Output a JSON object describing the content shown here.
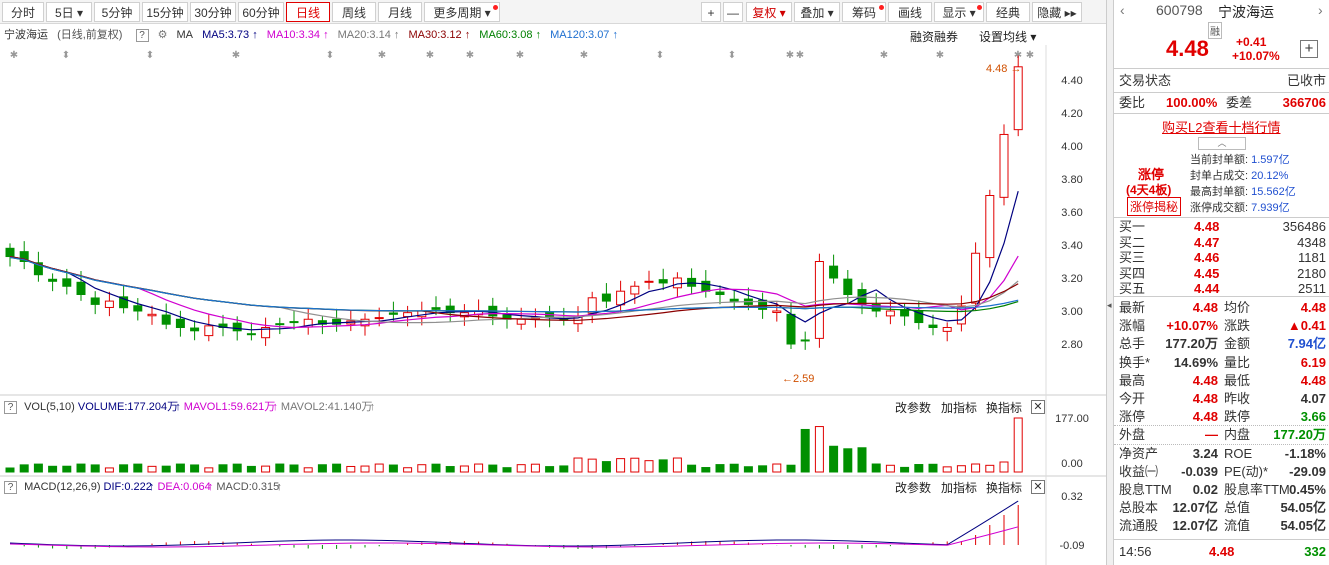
{
  "toolbar": {
    "periods": [
      "分时",
      "5日",
      "5分钟",
      "15分钟",
      "30分钟",
      "60分钟",
      "日线",
      "周线",
      "月线",
      "更多周期"
    ],
    "active_period": "日线",
    "right_buttons": [
      "复权",
      "叠加",
      "筹码",
      "画线",
      "显示",
      "经典",
      "隐藏"
    ],
    "plus": "+",
    "minus": "—"
  },
  "info": {
    "stock_name": "宁波海运",
    "mode": "(日线,前复权)",
    "ma_label": "MA",
    "ma5": "MA5:3.73",
    "ma10": "MA10:3.34",
    "ma20": "MA20:3.14",
    "ma30": "MA30:3.12",
    "ma60": "MA60:3.08",
    "ma120": "MA120:3.07",
    "margin_trading": "融资融券",
    "ma_settings": "设置均线"
  },
  "price_axis": [
    "4.40",
    "4.20",
    "4.00",
    "3.80",
    "3.60",
    "3.40",
    "3.20",
    "3.00",
    "2.80"
  ],
  "last_price_marker": "4.48",
  "low_marker": "2.59",
  "volume_panel": {
    "title": "VOL(5,10)",
    "volume": "VOLUME:177.204万",
    "mavol1": "MAVOL1:59.621万",
    "mavol2": "MAVOL2:41.140万",
    "actions": [
      "改参数",
      "加指标",
      "换指标"
    ],
    "axis_top": "177.00",
    "axis_bottom": "0.00"
  },
  "macd_panel": {
    "title": "MACD(12,26,9)",
    "dif": "DIF:0.222",
    "dea": "DEA:0.064",
    "macd": "MACD:0.315",
    "actions": [
      "改参数",
      "加指标",
      "换指标"
    ],
    "axis_top": "0.32",
    "axis_bottom": "-0.09"
  },
  "colors": {
    "up": "#e00000",
    "down": "#009000",
    "ma5": "#000080",
    "ma10": "#d000d0",
    "ma20": "#909090",
    "ma30": "#8b0000",
    "ma60": "#008000",
    "ma120": "#1e6fd0"
  },
  "quote": {
    "code": "600798",
    "name": "宁波海运",
    "tag": "融",
    "price": "4.48",
    "change": "+0.41",
    "change_pct": "+10.07%",
    "trade_status_label": "交易状态",
    "trade_status": "已收市",
    "weibi_label": "委比",
    "weibi": "100.00%",
    "weicha_label": "委差",
    "weicha": "366706",
    "l2_link": "购买L2查看十档行情",
    "limit_up": "涨停",
    "boards": "(4天4板)",
    "reveal": "涨停揭秘",
    "seal": [
      {
        "label": "当前封单额:",
        "value": "1.597亿"
      },
      {
        "label": "封单占成交:",
        "value": "20.12%"
      },
      {
        "label": "最高封单额:",
        "value": "15.562亿"
      },
      {
        "label": "涨停成交额:",
        "value": "7.939亿"
      }
    ],
    "bids": [
      {
        "label": "买一",
        "price": "4.48",
        "vol": "356486"
      },
      {
        "label": "买二",
        "price": "4.47",
        "vol": "4348"
      },
      {
        "label": "买三",
        "price": "4.46",
        "vol": "1181"
      },
      {
        "label": "买四",
        "price": "4.45",
        "vol": "2180"
      },
      {
        "label": "买五",
        "price": "4.44",
        "vol": "2511"
      }
    ],
    "stats": [
      {
        "l1": "最新",
        "v1": "4.48",
        "c1": "up",
        "l2": "均价",
        "v2": "4.48",
        "c2": "up"
      },
      {
        "l1": "涨幅",
        "v1": "+10.07%",
        "c1": "up",
        "l2": "涨跌",
        "v2": "▲0.41",
        "c2": "up"
      },
      {
        "l1": "总手",
        "v1": "177.20万",
        "c1": "",
        "l2": "金额",
        "v2": "7.94亿",
        "c2": "blu"
      },
      {
        "l1": "换手*",
        "v1": "14.69%",
        "c1": "",
        "l2": "量比",
        "v2": "6.19",
        "c2": "up"
      },
      {
        "l1": "最高",
        "v1": "4.48",
        "c1": "up",
        "l2": "最低",
        "v2": "4.48",
        "c2": "up"
      },
      {
        "l1": "今开",
        "v1": "4.48",
        "c1": "up",
        "l2": "昨收",
        "v2": "4.07",
        "c2": ""
      },
      {
        "l1": "涨停",
        "v1": "4.48",
        "c1": "up",
        "l2": "跌停",
        "v2": "3.66",
        "c2": "dn"
      },
      {
        "l1": "外盘",
        "v1": "—",
        "c1": "up",
        "l2": "内盘",
        "v2": "177.20万",
        "c2": "dn"
      },
      {
        "l1": "净资产",
        "v1": "3.24",
        "c1": "",
        "l2": "ROE",
        "v2": "-1.18%",
        "c2": ""
      },
      {
        "l1": "收益㈠",
        "v1": "-0.039",
        "c1": "",
        "l2": "PE(动)*",
        "v2": "-29.09",
        "c2": ""
      },
      {
        "l1": "股息TTM",
        "v1": "0.02",
        "c1": "",
        "l2": "股息率TTM",
        "v2": "0.45%",
        "c2": ""
      },
      {
        "l1": "总股本",
        "v1": "12.07亿",
        "c1": "",
        "l2": "总值",
        "v2": "54.05亿",
        "c2": ""
      },
      {
        "l1": "流通股",
        "v1": "12.07亿",
        "c1": "",
        "l2": "流值",
        "v2": "54.05亿",
        "c2": ""
      }
    ],
    "tick_time": "14:56",
    "tick_price": "4.48",
    "tick_vol": "332"
  }
}
